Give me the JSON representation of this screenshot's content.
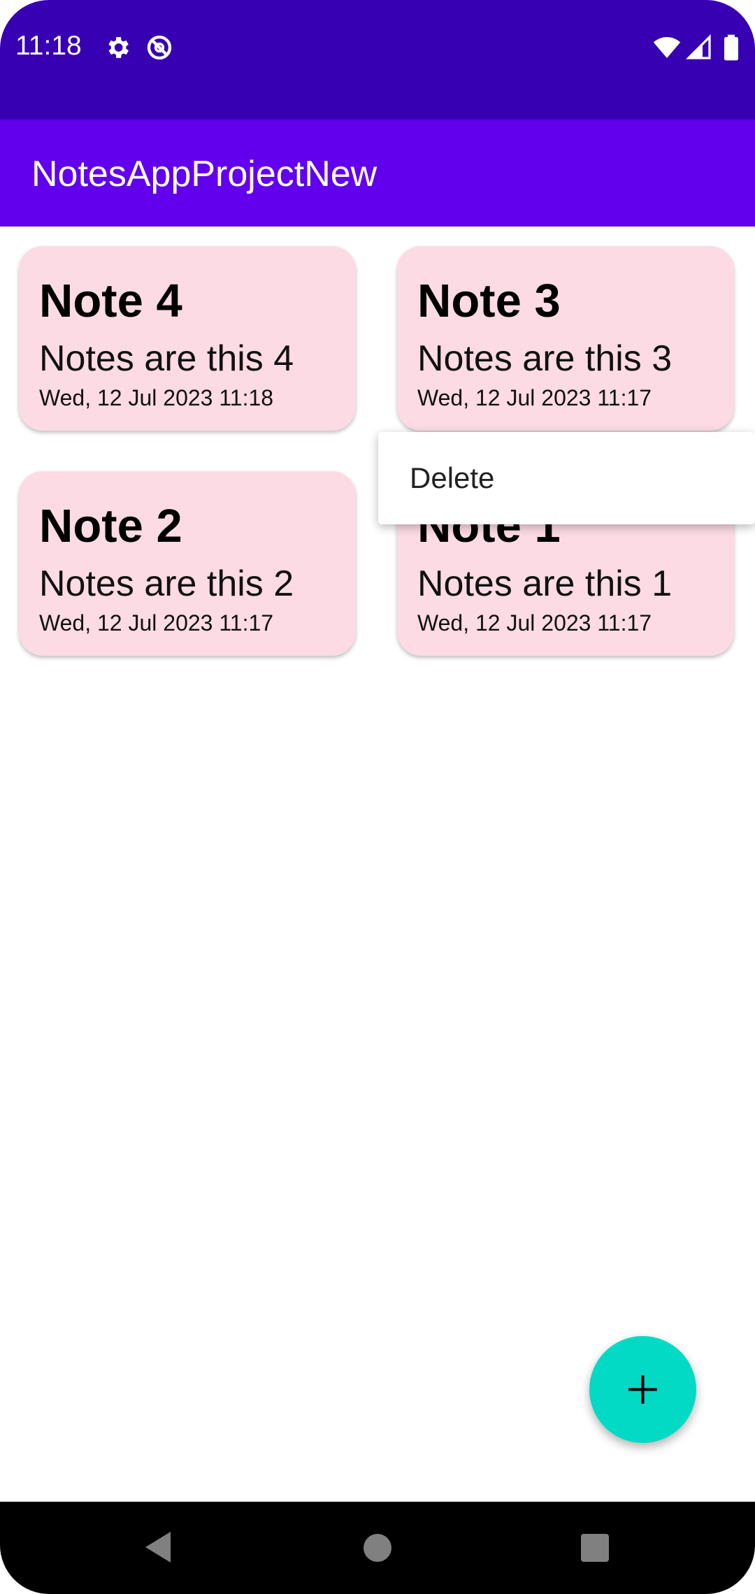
{
  "status_bar": {
    "time": "11:18",
    "icons": [
      "gear-icon",
      "no-tracking-icon",
      "wifi-icon",
      "signal-icon",
      "battery-icon"
    ]
  },
  "app_bar": {
    "title": "NotesAppProjectNew"
  },
  "notes": [
    {
      "title": "Note 4",
      "body": "Notes are this 4",
      "date": "Wed, 12 Jul 2023 11:18"
    },
    {
      "title": "Note 3",
      "body": "Notes are this 3",
      "date": "Wed, 12 Jul 2023 11:17"
    },
    {
      "title": "Note 2",
      "body": "Notes are this 2",
      "date": "Wed, 12 Jul 2023 11:17"
    },
    {
      "title": "Note 1",
      "body": "Notes are this 1",
      "date": "Wed, 12 Jul 2023 11:17"
    }
  ],
  "context_menu": {
    "items": [
      {
        "label": "Delete"
      }
    ]
  },
  "fab": {
    "icon": "plus-icon"
  },
  "nav_bar": {
    "icons": [
      "back-icon",
      "home-icon",
      "recents-icon"
    ]
  },
  "colors": {
    "status_bar": "#3700B3",
    "app_bar": "#6200EE",
    "card": "#FCDBE4",
    "fab": "#03DAC5"
  }
}
